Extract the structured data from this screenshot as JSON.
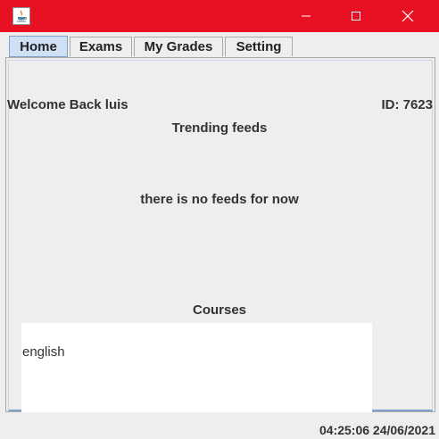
{
  "window": {
    "title": "",
    "icon": "java-app-icon",
    "titlebar_color": "#e81123",
    "controls": {
      "minimize": "minimize-icon",
      "maximize": "maximize-icon",
      "close": "close-icon"
    }
  },
  "tabs": [
    {
      "label": "Home",
      "active": true
    },
    {
      "label": "Exams",
      "active": false
    },
    {
      "label": "My Grades",
      "active": false
    },
    {
      "label": "Setting",
      "active": false
    }
  ],
  "home": {
    "welcome": "Welcome Back luis",
    "user_id": "ID: 7623",
    "trending_title": "Trending feeds",
    "feeds_message": "there is no feeds for now",
    "courses_title": "Courses",
    "courses": [
      "english"
    ]
  },
  "status": {
    "clock": "04:25:06 24/06/2021"
  }
}
